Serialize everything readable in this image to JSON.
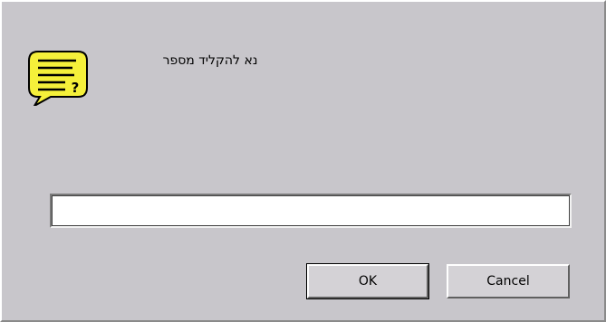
{
  "dialog": {
    "prompt": "נא להקליד מספר",
    "input_value": "",
    "ok_label": "OK",
    "cancel_label": "Cancel",
    "icon": "question-speech-bubble-icon",
    "colors": {
      "background": "#c8c6cb",
      "icon_fill": "#f5f03a"
    }
  }
}
